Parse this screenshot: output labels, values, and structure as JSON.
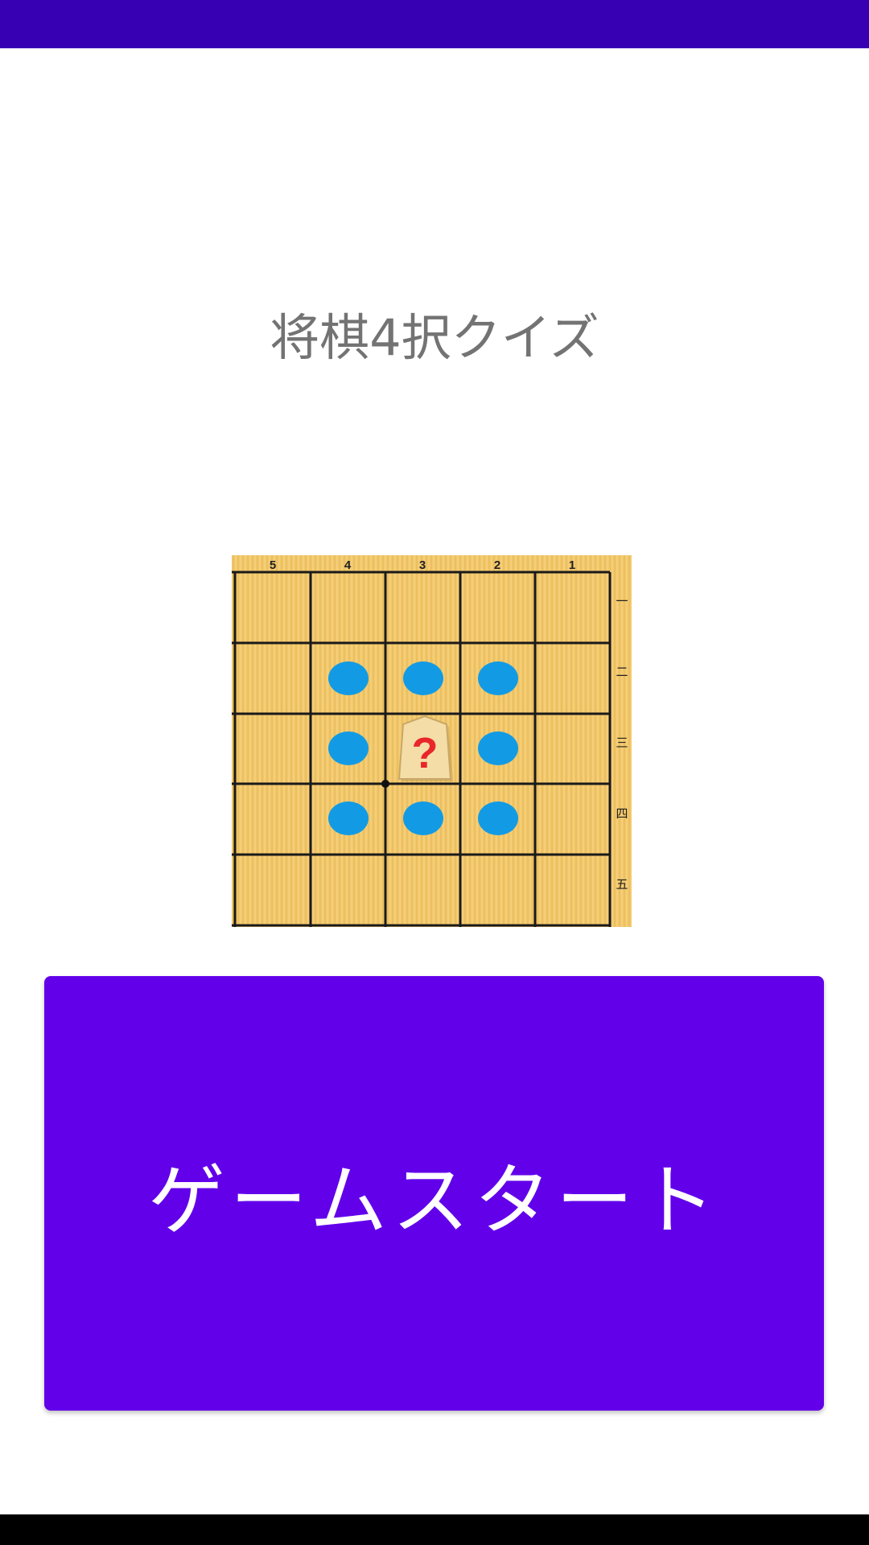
{
  "status_bar": {
    "color": "#3700b3"
  },
  "title": "将棋4択クイズ",
  "board": {
    "file_labels": [
      "5",
      "4",
      "3",
      "2",
      "1"
    ],
    "rank_labels": [
      "一",
      "二",
      "三",
      "四",
      "五"
    ],
    "piece_label": "?",
    "wood_color": "#f2c86b",
    "dot_color": "#129be4",
    "piece_mark_color": "#e8262c"
  },
  "start_button": {
    "label": "ゲームスタート",
    "color": "#6200ea"
  }
}
